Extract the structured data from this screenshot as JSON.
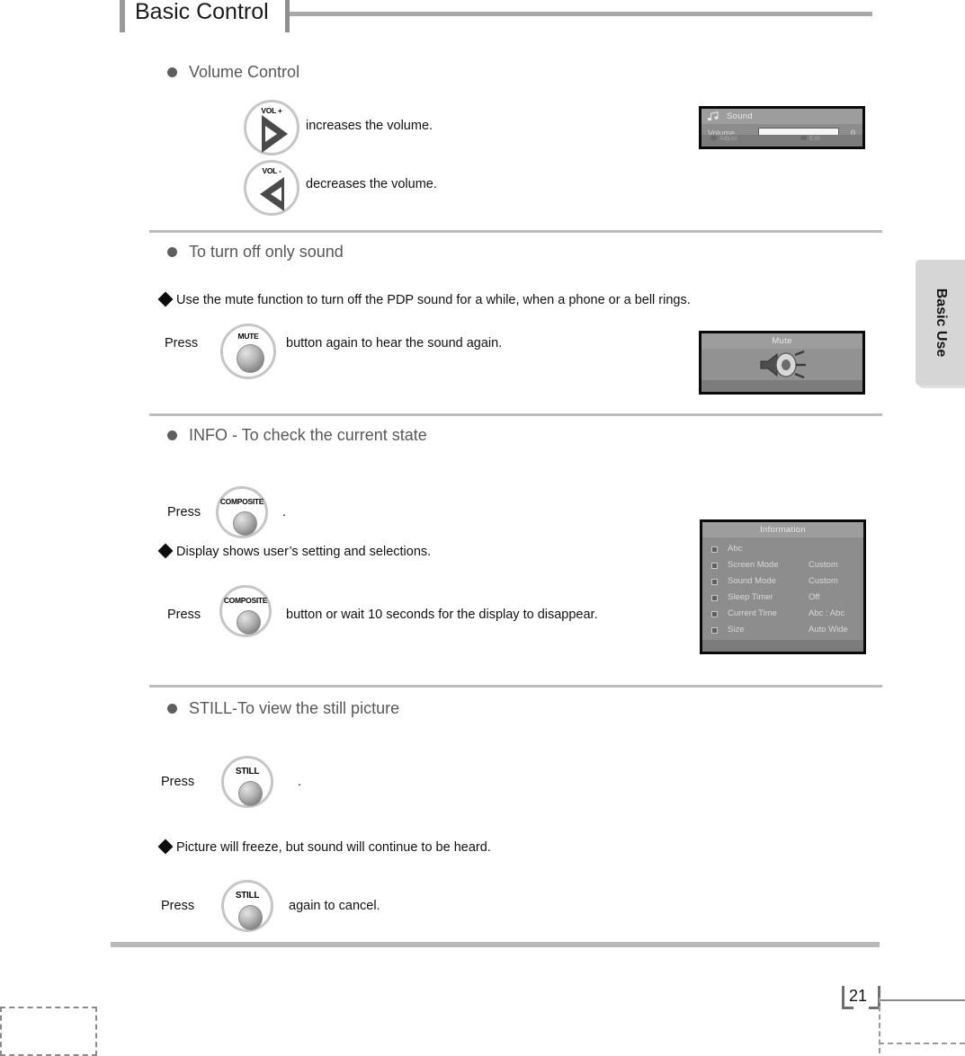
{
  "header": {
    "title": "Basic Control"
  },
  "side_tab": {
    "label": "Basic Use"
  },
  "footer": {
    "page_number": "21"
  },
  "sections": [
    {
      "id": "volume-control",
      "heading": "Volume Control",
      "rows": [
        {
          "button": "VOL +",
          "text": "increases the volume."
        },
        {
          "button": "VOL -",
          "text": "decreases the volume."
        }
      ]
    },
    {
      "id": "turn-off-sound",
      "heading": "To turn off only sound",
      "note": "Use the mute function to turn off the PDP sound for a while, when a phone or a bell rings.",
      "press_prefix": "Press",
      "button": "MUTE",
      "press_suffix": "button again to hear the sound again."
    },
    {
      "id": "info-state",
      "heading": "INFO - To check the current state",
      "press_prefix": "Press",
      "button": "COMPOSITE",
      "press_suffix": ".",
      "note": "Display shows user’s setting and selections.",
      "press_prefix_2": "Press",
      "button_2": "COMPOSITE",
      "press_suffix_2": "button or wait 10 seconds for the display to disappear."
    },
    {
      "id": "still-picture",
      "heading": "STILL-To view the still picture",
      "press_prefix": "Press",
      "button": "STILL",
      "press_suffix": ".",
      "note": "Picture will freeze, but sound will continue to be heard.",
      "press_prefix_2": "Press",
      "button_2": "STILL",
      "press_suffix_2": "again to cancel."
    }
  ],
  "osd": {
    "sound": {
      "title": "Sound",
      "volume_label": "Volume",
      "volume_value": "0",
      "foot_adjust": "Adjust",
      "foot_exit": "Exit"
    },
    "mute": {
      "title": "Mute"
    },
    "information": {
      "title": "Information",
      "rows": [
        {
          "key": "Abc",
          "value": ""
        },
        {
          "key": "Screen Mode",
          "value": "Custom"
        },
        {
          "key": "Sound Mode",
          "value": "Custom"
        },
        {
          "key": "Sleep Timer",
          "value": "Off"
        },
        {
          "key": "Current Time",
          "value": "Abc : Abc"
        },
        {
          "key": "Size",
          "value": "Auto Wide"
        }
      ]
    }
  }
}
